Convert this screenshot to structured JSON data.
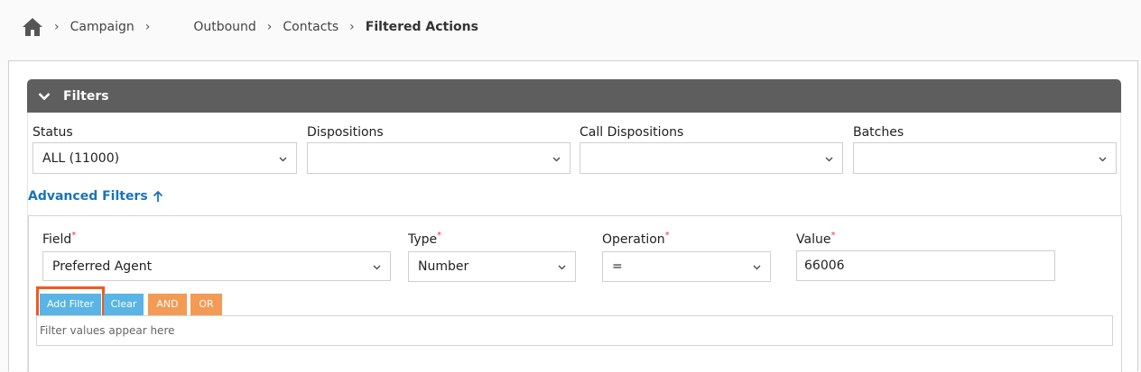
{
  "breadcrumb": {
    "home_icon": "home-icon",
    "items": [
      "Campaign",
      "Outbound",
      "Contacts",
      "Filtered Actions"
    ]
  },
  "filters": {
    "title": "Filters",
    "toggle_icon": "chevron-down-icon",
    "status": {
      "label": "Status",
      "value": "ALL (11000)"
    },
    "dispositions": {
      "label": "Dispositions",
      "value": ""
    },
    "call_dispositions": {
      "label": "Call Dispositions",
      "value": ""
    },
    "batches": {
      "label": "Batches",
      "value": ""
    }
  },
  "advanced": {
    "link_label": "Advanced Filters",
    "link_icon": "arrow-up-icon",
    "field": {
      "label": "Field",
      "required": "*",
      "value": "Preferred Agent"
    },
    "type": {
      "label": "Type",
      "required": "*",
      "value": "Number"
    },
    "operation": {
      "label": "Operation",
      "required": "*",
      "value": "="
    },
    "value": {
      "label": "Value",
      "required": "*",
      "value": "66006"
    },
    "buttons": {
      "add_filter": "Add Filter",
      "clear": "Clear",
      "and": "AND",
      "or": "OR"
    },
    "filter_values_placeholder": "Filter values appear here"
  },
  "colors": {
    "header_bg": "#5e5e5e",
    "link": "#1a73b8",
    "button_blue": "#5ab4e5",
    "button_orange": "#f39a55",
    "highlight": "#f05a1c",
    "required": "#e23b3b"
  }
}
